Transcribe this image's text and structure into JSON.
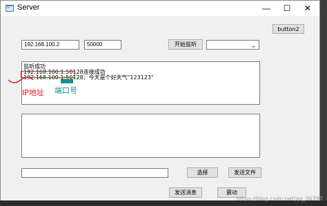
{
  "window": {
    "title": "Server",
    "controls": {
      "minimize": "—",
      "maximize": "☐",
      "close": "✕"
    }
  },
  "buttons": {
    "button2": "button2",
    "start_listen": "开始监听",
    "choose": "选择",
    "send_file": "发送文件",
    "send_message": "发送消息",
    "shake": "震动"
  },
  "inputs": {
    "ip": "192.168.100.2",
    "port": "50000",
    "file_path": ""
  },
  "combo": {
    "selected": ""
  },
  "log": {
    "lines": [
      "监听成功",
      "192.168.100.1:50128连接成功",
      "192.168.100.1:50128：今天是个好天气\"123123\""
    ]
  },
  "annotations": {
    "ip_label": "IP地址",
    "port_label": "端口号"
  },
  "watermark": "https://blog.csdn.net/qq_36397"
}
